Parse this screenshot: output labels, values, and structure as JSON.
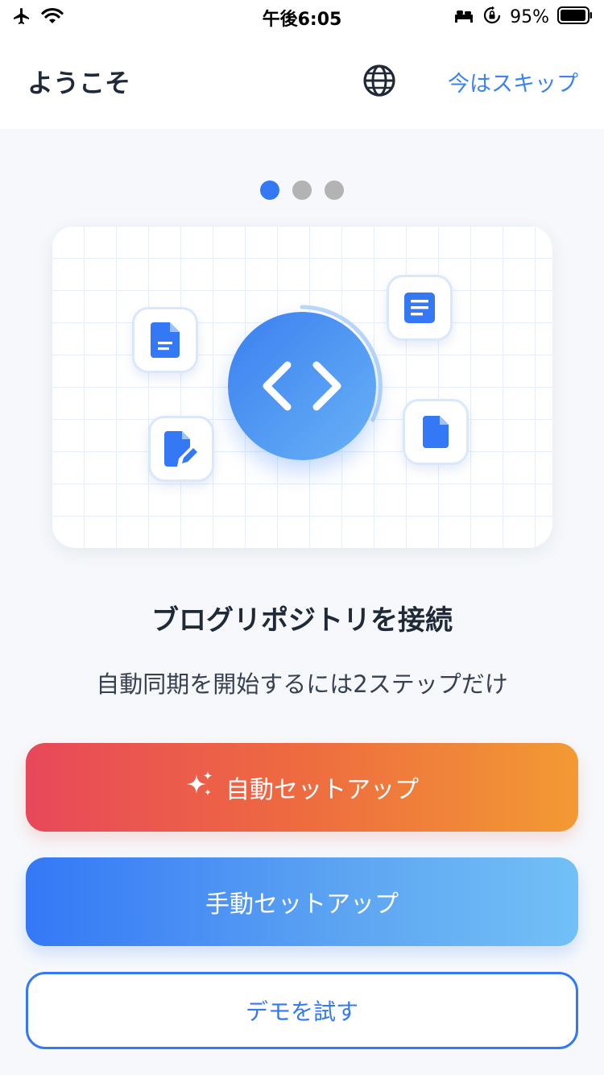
{
  "status_bar": {
    "time": "午後6:05",
    "battery": "95%",
    "icons": [
      "airplane-icon",
      "wifi-icon",
      "bed-icon",
      "rotation-lock-icon",
      "battery-icon"
    ]
  },
  "header": {
    "title": "ようこそ",
    "globe_icon": "globe-icon",
    "skip_label": "今はスキップ"
  },
  "pager": {
    "count": 3,
    "active_index": 0
  },
  "illustration": {
    "center_icon": "code-icon",
    "tiles": [
      "document-icon",
      "document-lines-icon",
      "edit-document-icon",
      "file-icon"
    ]
  },
  "content": {
    "headline": "ブログリポジトリを接続",
    "subline": "自動同期を開始するには2ステップだけ"
  },
  "buttons": {
    "auto_setup": "自動セットアップ",
    "manual_setup": "手動セットアップ",
    "demo": "デモを試す"
  },
  "colors": {
    "accent": "#3478f6",
    "auto_gradient": [
      "#e8485a",
      "#f29a33"
    ],
    "manual_gradient": [
      "#3478f6",
      "#72c0f7"
    ]
  }
}
